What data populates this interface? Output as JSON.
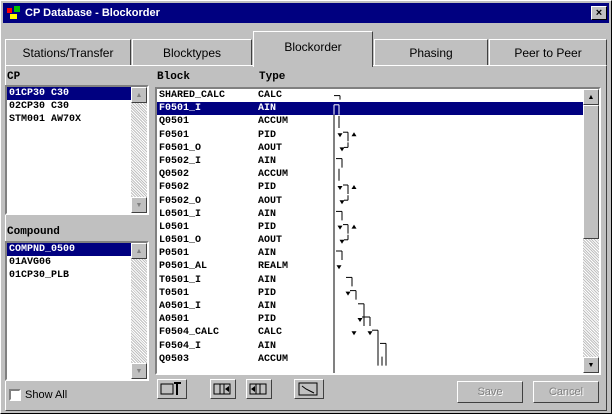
{
  "window": {
    "title": "CP Database - Blockorder",
    "close_label": "×"
  },
  "tabs": [
    {
      "label": "Stations/Transfer",
      "active": false
    },
    {
      "label": "Blocktypes",
      "active": false
    },
    {
      "label": "Blockorder",
      "active": true
    },
    {
      "label": "Phasing",
      "active": false
    },
    {
      "label": "Peer to Peer",
      "active": false
    }
  ],
  "cp_list": {
    "label": "CP",
    "items": [
      "01CP30 C30",
      "02CP30 C30",
      "STM001 AW70X"
    ],
    "selected_index": 0
  },
  "compound_list": {
    "label": "Compound",
    "items": [
      "COMPND_0500",
      "01AVG06",
      "01CP30_PLB"
    ],
    "selected_index": 0
  },
  "show_all": {
    "label": "Show All",
    "checked": false
  },
  "block_table": {
    "headers": {
      "block": "Block",
      "type": "Type"
    },
    "selected_index": 1,
    "rows": [
      {
        "block": "SHARED_CALC",
        "type": "CALC"
      },
      {
        "block": "F0501_I",
        "type": "AIN"
      },
      {
        "block": "Q0501",
        "type": "ACCUM"
      },
      {
        "block": "F0501",
        "type": "PID"
      },
      {
        "block": "F0501_O",
        "type": "AOUT"
      },
      {
        "block": "F0502_I",
        "type": "AIN"
      },
      {
        "block": "Q0502",
        "type": "ACCUM"
      },
      {
        "block": "F0502",
        "type": "PID"
      },
      {
        "block": "F0502_O",
        "type": "AOUT"
      },
      {
        "block": "L0501_I",
        "type": "AIN"
      },
      {
        "block": "L0501",
        "type": "PID"
      },
      {
        "block": "L0501_O",
        "type": "AOUT"
      },
      {
        "block": "P0501",
        "type": "AIN"
      },
      {
        "block": "P0501_AL",
        "type": "REALM"
      },
      {
        "block": "T0501_I",
        "type": "AIN"
      },
      {
        "block": "T0501",
        "type": "PID"
      },
      {
        "block": "A0501_I",
        "type": "AIN"
      },
      {
        "block": "A0501",
        "type": "PID"
      },
      {
        "block": "F0504_CALC",
        "type": "CALC"
      },
      {
        "block": "F0504_I",
        "type": "AIN"
      },
      {
        "block": "Q0503",
        "type": "ACCUM"
      }
    ]
  },
  "toolbar_icons": [
    "move-to-top-icon",
    "move-up-icon",
    "move-down-icon",
    "sort-icon"
  ],
  "buttons": {
    "save": "Save",
    "cancel": "Cancel"
  },
  "colors": {
    "titlebar": "#000080",
    "selection": "#000080",
    "face": "#c0c0c0"
  }
}
